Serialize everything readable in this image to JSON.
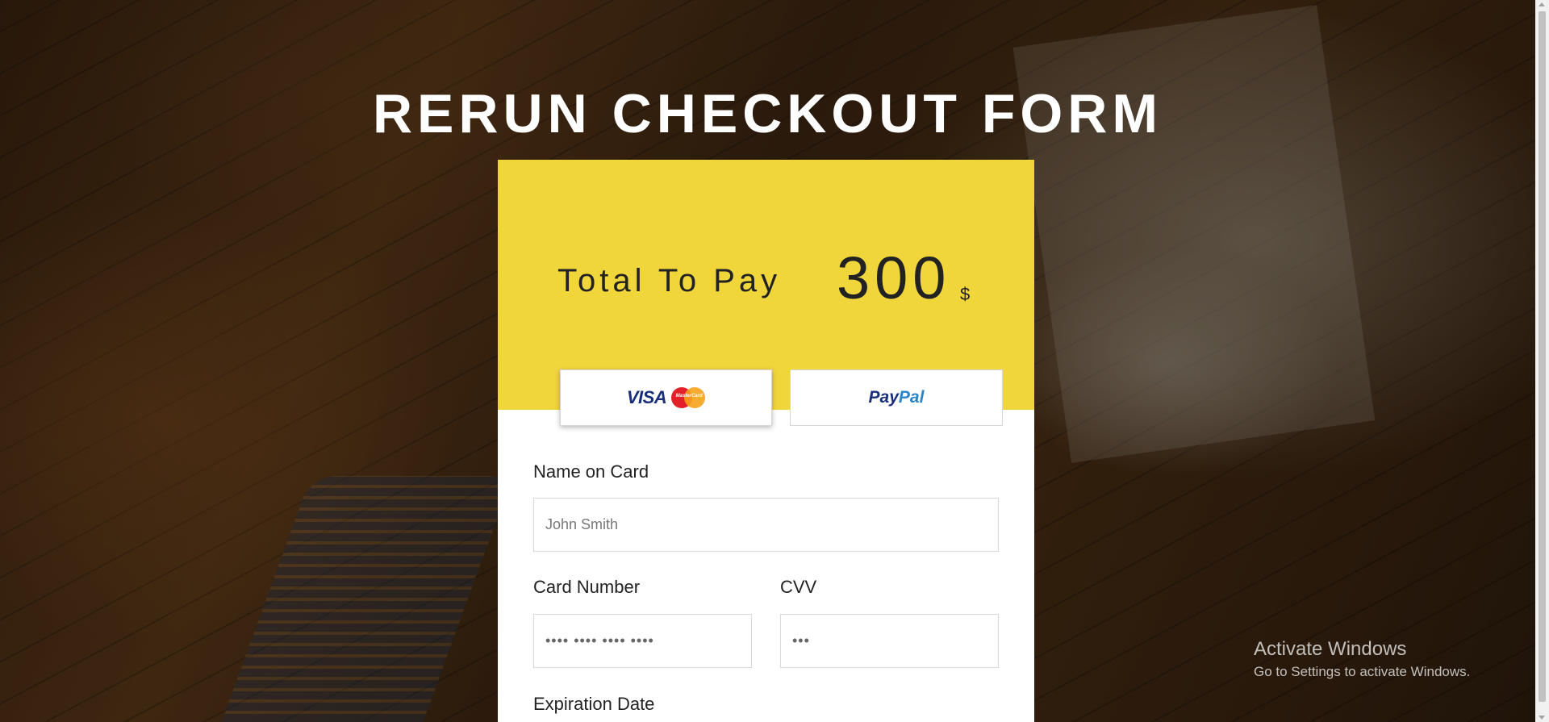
{
  "page": {
    "title": "RERUN CHECKOUT FORM"
  },
  "summary": {
    "total_label": "Total To Pay",
    "amount": "300",
    "currency": "$"
  },
  "payment_methods": {
    "visa_label": "VISA",
    "mastercard_label": "MasterCard",
    "paypal_part1": "Pay",
    "paypal_part2": "Pal",
    "selected": "card"
  },
  "form": {
    "name_label": "Name on Card",
    "name_placeholder": "John Smith",
    "card_number_label": "Card Number",
    "card_number_placeholder": "•••• •••• •••• ••••",
    "cvv_label": "CVV",
    "cvv_placeholder": "•••",
    "expiration_label": "Expiration Date"
  },
  "windows_notice": {
    "line1": "Activate Windows",
    "line2": "Go to Settings to activate Windows."
  },
  "colors": {
    "accent": "#f0d53b",
    "title": "#ffffff",
    "card_bg": "#ffffff"
  }
}
